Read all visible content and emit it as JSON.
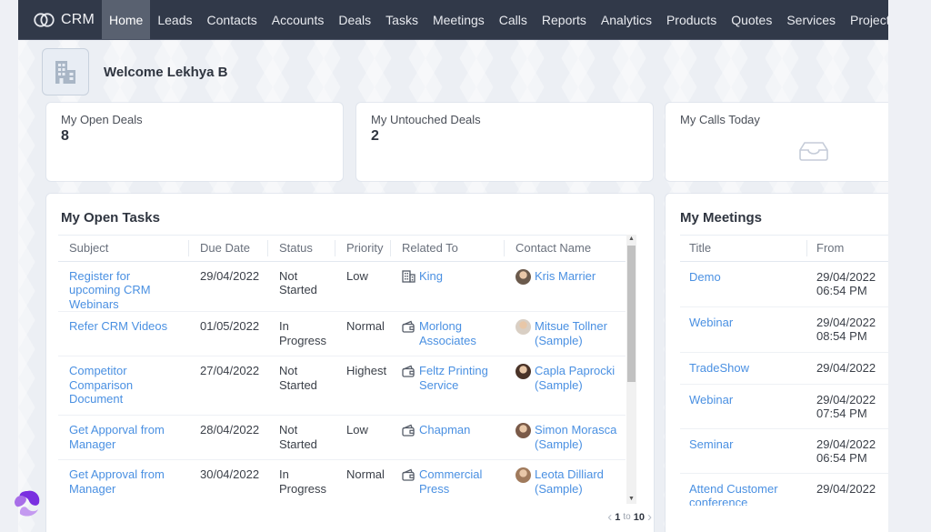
{
  "nav": {
    "brand": "CRM",
    "items": [
      {
        "label": "Home",
        "active": true
      },
      {
        "label": "Leads"
      },
      {
        "label": "Contacts"
      },
      {
        "label": "Accounts"
      },
      {
        "label": "Deals"
      },
      {
        "label": "Tasks"
      },
      {
        "label": "Meetings"
      },
      {
        "label": "Calls"
      },
      {
        "label": "Reports"
      },
      {
        "label": "Analytics"
      },
      {
        "label": "Products"
      },
      {
        "label": "Quotes"
      },
      {
        "label": "Services"
      },
      {
        "label": "Projects"
      }
    ]
  },
  "welcome": {
    "text": "Welcome Lekhya B",
    "icon": "building-icon"
  },
  "stats": [
    {
      "label": "My Open Deals",
      "value": "8"
    },
    {
      "label": "My Untouched Deals",
      "value": "2"
    },
    {
      "label": "My Calls Today",
      "value": null,
      "empty_icon": "inbox-icon"
    }
  ],
  "tasks": {
    "title": "My Open Tasks",
    "columns": [
      "Subject",
      "Due Date",
      "Status",
      "Priority",
      "Related To",
      "Contact Name"
    ],
    "rows": [
      {
        "subject": "Register for upcoming CRM Webinars",
        "due": "29/04/2022",
        "status": "Not Started",
        "priority": "Low",
        "related": "King",
        "related_icon": "account-building-icon",
        "contact": "Kris Marrier",
        "avatar_color": "#6b5a4c"
      },
      {
        "subject": "Refer CRM Videos",
        "due": "01/05/2022",
        "status": "In Progress",
        "priority": "Normal",
        "related": "Morlong Associates",
        "related_icon": "deal-wallet-icon",
        "contact": "Mitsue Tollner (Sample)",
        "avatar_color": "#d9cfc4"
      },
      {
        "subject": "Competitor Comparison Document",
        "due": "27/04/2022",
        "status": "Not Started",
        "priority": "Highest",
        "related": "Feltz Printing Service",
        "related_icon": "deal-wallet-icon",
        "contact": "Capla Paprocki (Sample)",
        "avatar_color": "#4a3328"
      },
      {
        "subject": "Get Apporval from Manager",
        "due": "28/04/2022",
        "status": "Not Started",
        "priority": "Low",
        "related": "Chapman",
        "related_icon": "deal-wallet-icon",
        "contact": "Simon Morasca (Sample)",
        "avatar_color": "#7a5a48"
      },
      {
        "subject": "Get Approval from Manager",
        "due": "30/04/2022",
        "status": "In Progress",
        "priority": "Normal",
        "related": "Commercial Press",
        "related_icon": "deal-wallet-icon",
        "contact": "Leota Dilliard (Sample)",
        "avatar_color": "#a07a5c"
      }
    ],
    "pager": {
      "from": "1",
      "to_label": "to",
      "to": "10"
    }
  },
  "meetings": {
    "title": "My Meetings",
    "columns": [
      "Title",
      "From"
    ],
    "rows": [
      {
        "title": "Demo",
        "date": "29/04/2022",
        "time": "06:54 PM"
      },
      {
        "title": "Webinar",
        "date": "29/04/2022",
        "time": "08:54 PM"
      },
      {
        "title": "TradeShow",
        "date": "29/04/2022",
        "time": ""
      },
      {
        "title": "Webinar",
        "date": "29/04/2022",
        "time": "07:54 PM"
      },
      {
        "title": "Seminar",
        "date": "29/04/2022",
        "time": "06:54 PM"
      },
      {
        "title": "Attend Customer conference",
        "date": "29/04/2022",
        "time": ""
      }
    ]
  },
  "colors": {
    "nav_bg": "#313949",
    "nav_active": "#596170",
    "link": "#4a90e2",
    "page_bg": "#eceff4"
  }
}
